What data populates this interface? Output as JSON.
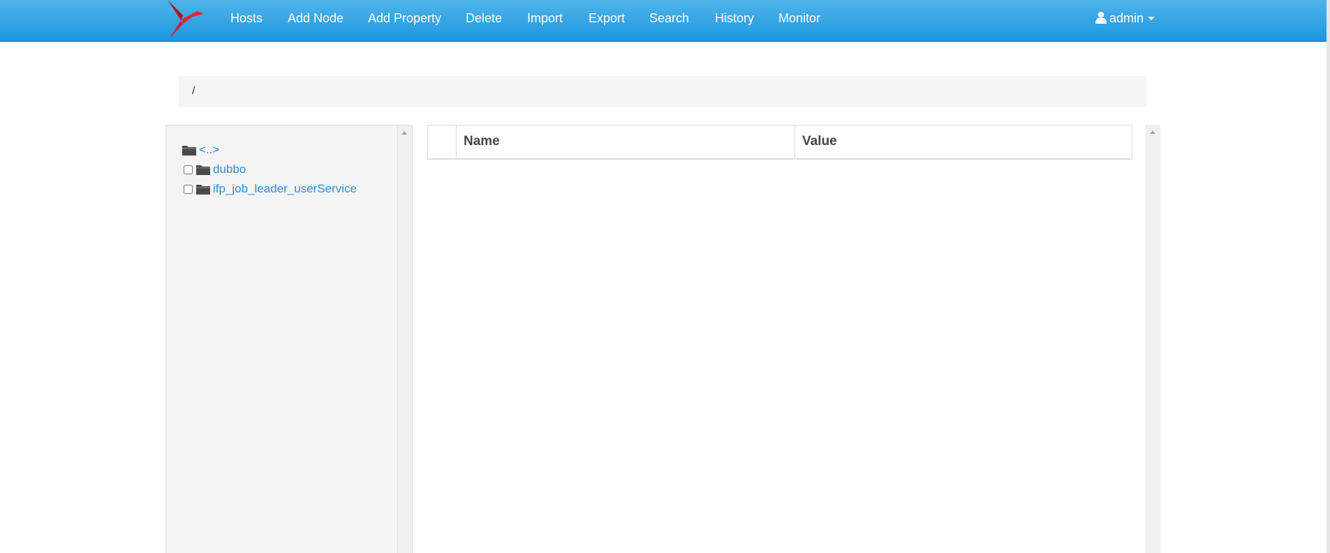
{
  "nav": {
    "items": [
      "Hosts",
      "Add Node",
      "Add Property",
      "Delete",
      "Import",
      "Export",
      "Search",
      "History",
      "Monitor"
    ],
    "user_label": "admin"
  },
  "breadcrumb": {
    "path": "/"
  },
  "tree": {
    "parent_label": "<..>",
    "nodes": [
      {
        "label": "dubbo"
      },
      {
        "label": "ifp_job_leader_userService"
      }
    ]
  },
  "table": {
    "headers": [
      "Name",
      "Value"
    ]
  },
  "colors": {
    "navbar": "#1c97e0",
    "link": "#2a8ed6",
    "logo": "#d0202e"
  }
}
